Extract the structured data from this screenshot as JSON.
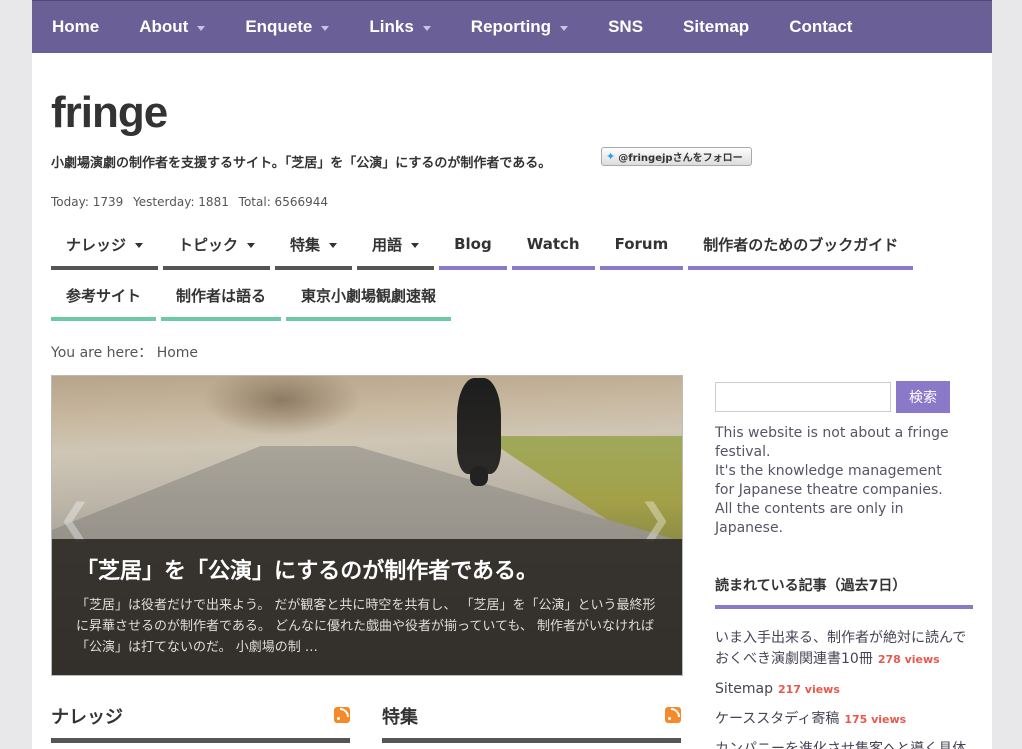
{
  "top_nav": [
    {
      "label": "Home",
      "caret": false
    },
    {
      "label": "About",
      "caret": true
    },
    {
      "label": "Enquete",
      "caret": true
    },
    {
      "label": "Links",
      "caret": true
    },
    {
      "label": "Reporting",
      "caret": true
    },
    {
      "label": "SNS",
      "caret": false
    },
    {
      "label": "Sitemap",
      "caret": false
    },
    {
      "label": "Contact",
      "caret": false
    }
  ],
  "site": {
    "logo": "fringe",
    "tagline": "小劇場演劇の制作者を支援するサイト。「芝居」を「公演」にするのが制作者である。",
    "follow_button": "@fringejpさんをフォロー"
  },
  "counter": {
    "today": "Today: 1739",
    "yesterday": "Yesterday: 1881",
    "total": "Total: 6566944"
  },
  "sub_nav_row1": [
    {
      "label": "ナレッジ",
      "caret": true
    },
    {
      "label": "トピック",
      "caret": true
    },
    {
      "label": "特集",
      "caret": true
    },
    {
      "label": "用語",
      "caret": true
    },
    {
      "label": "Blog",
      "caret": false
    },
    {
      "label": "Watch",
      "caret": false
    },
    {
      "label": "Forum",
      "caret": false
    },
    {
      "label": "制作者のためのブックガイド",
      "caret": false
    }
  ],
  "sub_nav_row2": [
    {
      "label": "参考サイト"
    },
    {
      "label": "制作者は語る"
    },
    {
      "label": "東京小劇場観劇速報"
    }
  ],
  "breadcrumb": {
    "prefix": "You are here：",
    "current": "Home"
  },
  "slider": {
    "title": "「芝居」を「公演」にするのが制作者である。",
    "excerpt": "「芝居」は役者だけで出来よう。 だが観客と共に時空を共有し、 「芝居」を「公演」という最終形に昇華させるのが制作者である。 どんなに優れた戯曲や役者が揃っていても、 制作者がいなければ「公演」は打てないのだ。 小劇場の制 …",
    "prev_icon": "chevron-left-icon",
    "next_icon": "chevron-right-icon"
  },
  "widgets": {
    "left_title": "ナレッジ",
    "right_title": "特集"
  },
  "search": {
    "placeholder": "",
    "button": "検索"
  },
  "about": [
    "This website is not about a fringe festival.",
    "It's the knowledge management for Japanese theatre companies.",
    "All the contents are only in Japanese."
  ],
  "popular": {
    "title": "読まれている記事（過去7日）",
    "items": [
      {
        "title": "いま入手出来る、制作者が絶対に読んでおくべき演劇関連書10冊",
        "views": "278 views"
      },
      {
        "title": "Sitemap",
        "views": "217 views"
      },
      {
        "title": "ケーススタディ寄稿",
        "views": "175 views"
      },
      {
        "title": "カンパニーを進化させ集客へと導く具体",
        "views": ""
      }
    ]
  },
  "colors": {
    "nav": "#6a5f96",
    "accent_purple": "#8a78c8",
    "accent_green": "#6ccaa5",
    "views_red": "#e8584c"
  }
}
